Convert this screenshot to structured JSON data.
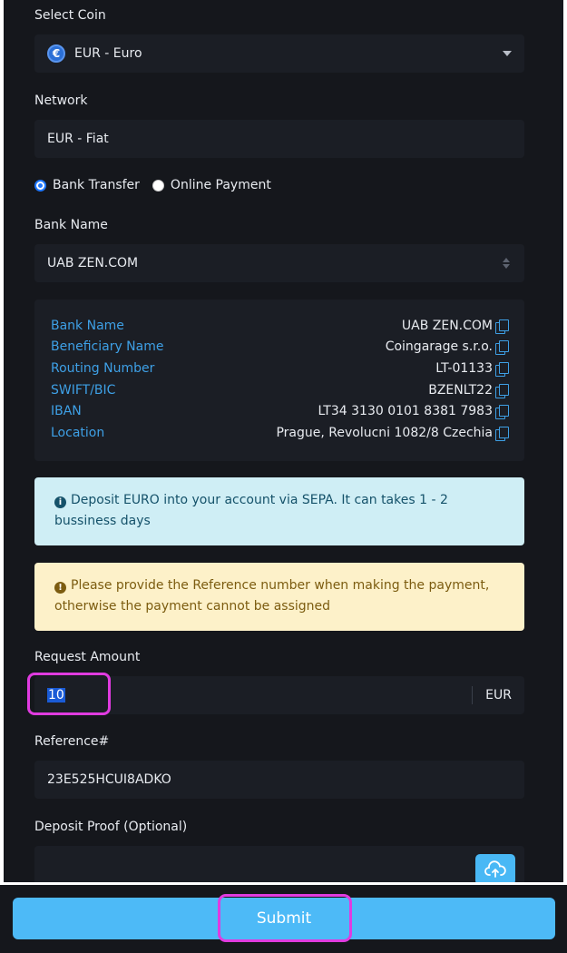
{
  "form": {
    "coin_label": "Select Coin",
    "coin_icon_symbol": "€",
    "coin_value": "EUR - Euro",
    "network_label": "Network",
    "network_value": "EUR - Fiat",
    "methods": [
      {
        "label": "Bank Transfer",
        "selected": true
      },
      {
        "label": "Online Payment",
        "selected": false
      }
    ],
    "bank_name_label": "Bank Name",
    "bank_name_value": "UAB ZEN.COM"
  },
  "bank_details": [
    {
      "key": "Bank Name",
      "value": "UAB ZEN.COM"
    },
    {
      "key": "Beneficiary Name",
      "value": "Coingarage s.r.o."
    },
    {
      "key": "Routing Number",
      "value": "LT-01133"
    },
    {
      "key": "SWIFT/BIC",
      "value": "BZENLT22"
    },
    {
      "key": "IBAN",
      "value": "LT34 3130 0101 8381 7983"
    },
    {
      "key": "Location",
      "value": "Prague, Revolucni 1082/8 Czechia"
    }
  ],
  "alerts": {
    "info_icon": "i",
    "info": "Deposit EURO into your account via SEPA. It can takes 1 - 2 bussiness days",
    "warn_icon": "!",
    "warn": "Please provide the Reference number when making the payment, otherwise the payment cannot be assigned"
  },
  "amount": {
    "label": "Request Amount",
    "value": "10",
    "unit": "EUR"
  },
  "reference": {
    "label": "Reference#",
    "value": "23E525HCUI8ADKO"
  },
  "proof": {
    "label": "Deposit Proof (Optional)"
  },
  "footer": {
    "submit_label": "Submit"
  },
  "colors": {
    "accent": "#4dbaf7",
    "highlight": "#e03be0",
    "link": "#3ea0e6"
  }
}
